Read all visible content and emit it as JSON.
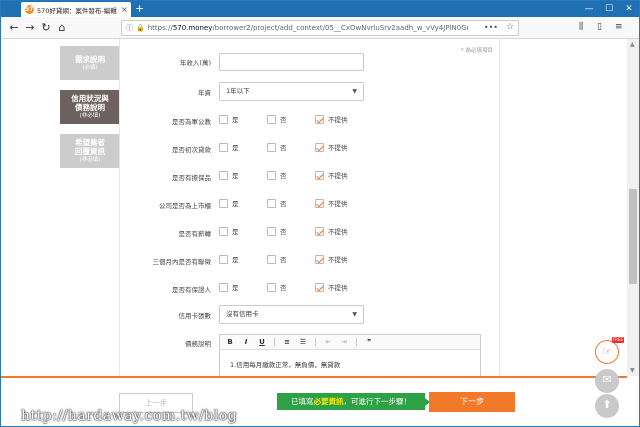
{
  "browser": {
    "tab_icon": "570",
    "tab_title": "570好貸網：案件發布-編輯案",
    "tab_close": "×",
    "new_tab": "+",
    "url_domain": "570.money",
    "url_prefix": "https://",
    "url_path": "/borrower2/project/add_context/05__CxOwNvrluSrv2aadh_w_vVy4JPlN0GnJ2H",
    "url_menu": "•••",
    "window_controls": [
      "—",
      "☐",
      "✕"
    ]
  },
  "sidebar": {
    "steps": [
      {
        "title": "需求說明",
        "sub": "(必填)"
      },
      {
        "title": "信用狀況與\n債務說明",
        "sub": "(非必填)"
      },
      {
        "title": "希望業者\n回覆資訊",
        "sub": "(非必填)"
      }
    ]
  },
  "form": {
    "required_note": "* 為必填項目",
    "income_label": "年收入(萬)",
    "income_value": "",
    "seniority_label": "年資",
    "seniority_value": "1年以下",
    "yes": "是",
    "no": "否",
    "na": "不提供",
    "questions": [
      "是否為軍公教",
      "是否初次貸款",
      "是否有擔保品",
      "公司是否為上市櫃",
      "是否有薪轉",
      "三個月內是否有聯徵",
      "是否有保證人"
    ],
    "credit_card_label": "信用卡張數",
    "credit_card_value": "沒有信用卡",
    "debt_label": "債務說明",
    "debt_text": "1.信用每月繳款正常，無負債，無貸款",
    "toolbar": [
      "B",
      "I",
      "U",
      "≡",
      "☰",
      "⇤",
      "⇥",
      "❞"
    ]
  },
  "footer": {
    "prev_label": "上一步",
    "notice_prefix": "已填寫",
    "notice_bold": "必要資訊",
    "notice_suffix": "，可進行下一步驟！",
    "next_label": "下一步",
    "free_badge": "FREE"
  },
  "watermark": "http://hardaway.com.tw/blog",
  "colors": {
    "accent": "#f2792a",
    "active_step": "#6e6260",
    "notice_green": "#2ea046",
    "tabbar": "#1f6fb3"
  }
}
